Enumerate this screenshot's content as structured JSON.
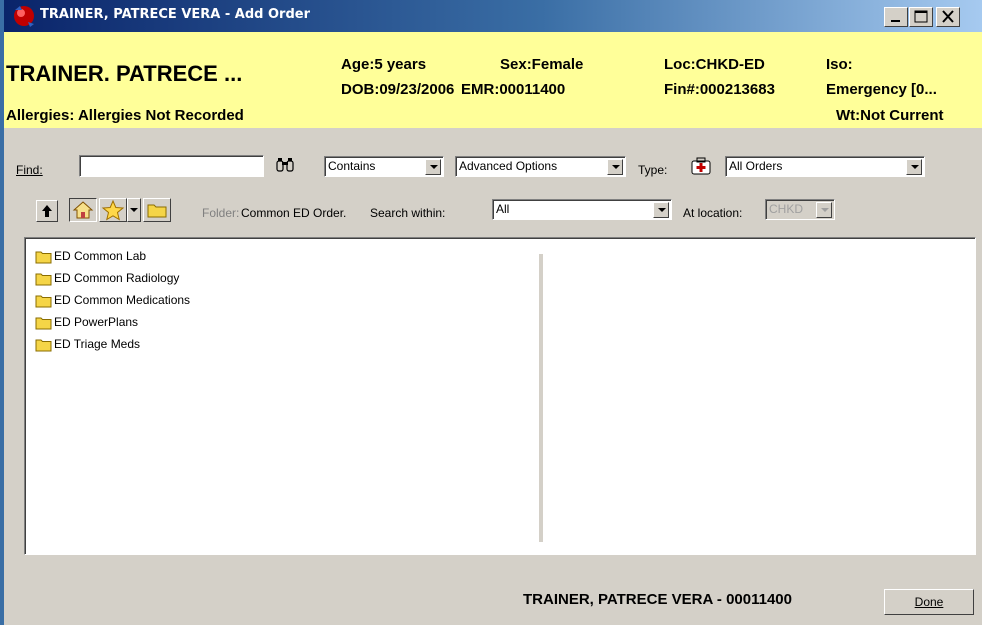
{
  "window": {
    "title": "TRAINER, PATRECE VERA - Add Order"
  },
  "banner": {
    "patient_name": "TRAINER. PATRECE ...",
    "age": "Age:5 years",
    "sex": "Sex:Female",
    "location": "Loc:CHKD-ED",
    "iso": "Iso:",
    "dob": "DOB:09/23/2006",
    "emr": "EMR:00011400",
    "fin": "Fin#:000213683",
    "encounter": "Emergency [0...",
    "allergies": "Allergies: Allergies Not Recorded",
    "weight": "Wt:Not Current"
  },
  "search": {
    "find_label": "Find:",
    "find_value": "",
    "match_mode": "Contains",
    "advanced": "Advanced Options",
    "type_label": "Type:",
    "type_value": "All Orders"
  },
  "folder_bar": {
    "folder_label": "Folder:",
    "folder_value": "Common ED Order.",
    "search_within_label": "Search within:",
    "search_within_value": "All",
    "at_location_label": "At location:",
    "at_location_value": "CHKD"
  },
  "folders": [
    {
      "label": "ED Common Lab"
    },
    {
      "label": "ED Common Radiology"
    },
    {
      "label": "ED Common Medications"
    },
    {
      "label": "ED PowerPlans"
    },
    {
      "label": "ED Triage Meds"
    }
  ],
  "footer": {
    "patient_summary": "TRAINER, PATRECE VERA - 00011400",
    "done_label": "Done"
  },
  "colors": {
    "banner_bg": "#ffff99",
    "titlebar_start": "#0a246a",
    "titlebar_end": "#a6caf0",
    "window_bg": "#d4d0c8"
  }
}
